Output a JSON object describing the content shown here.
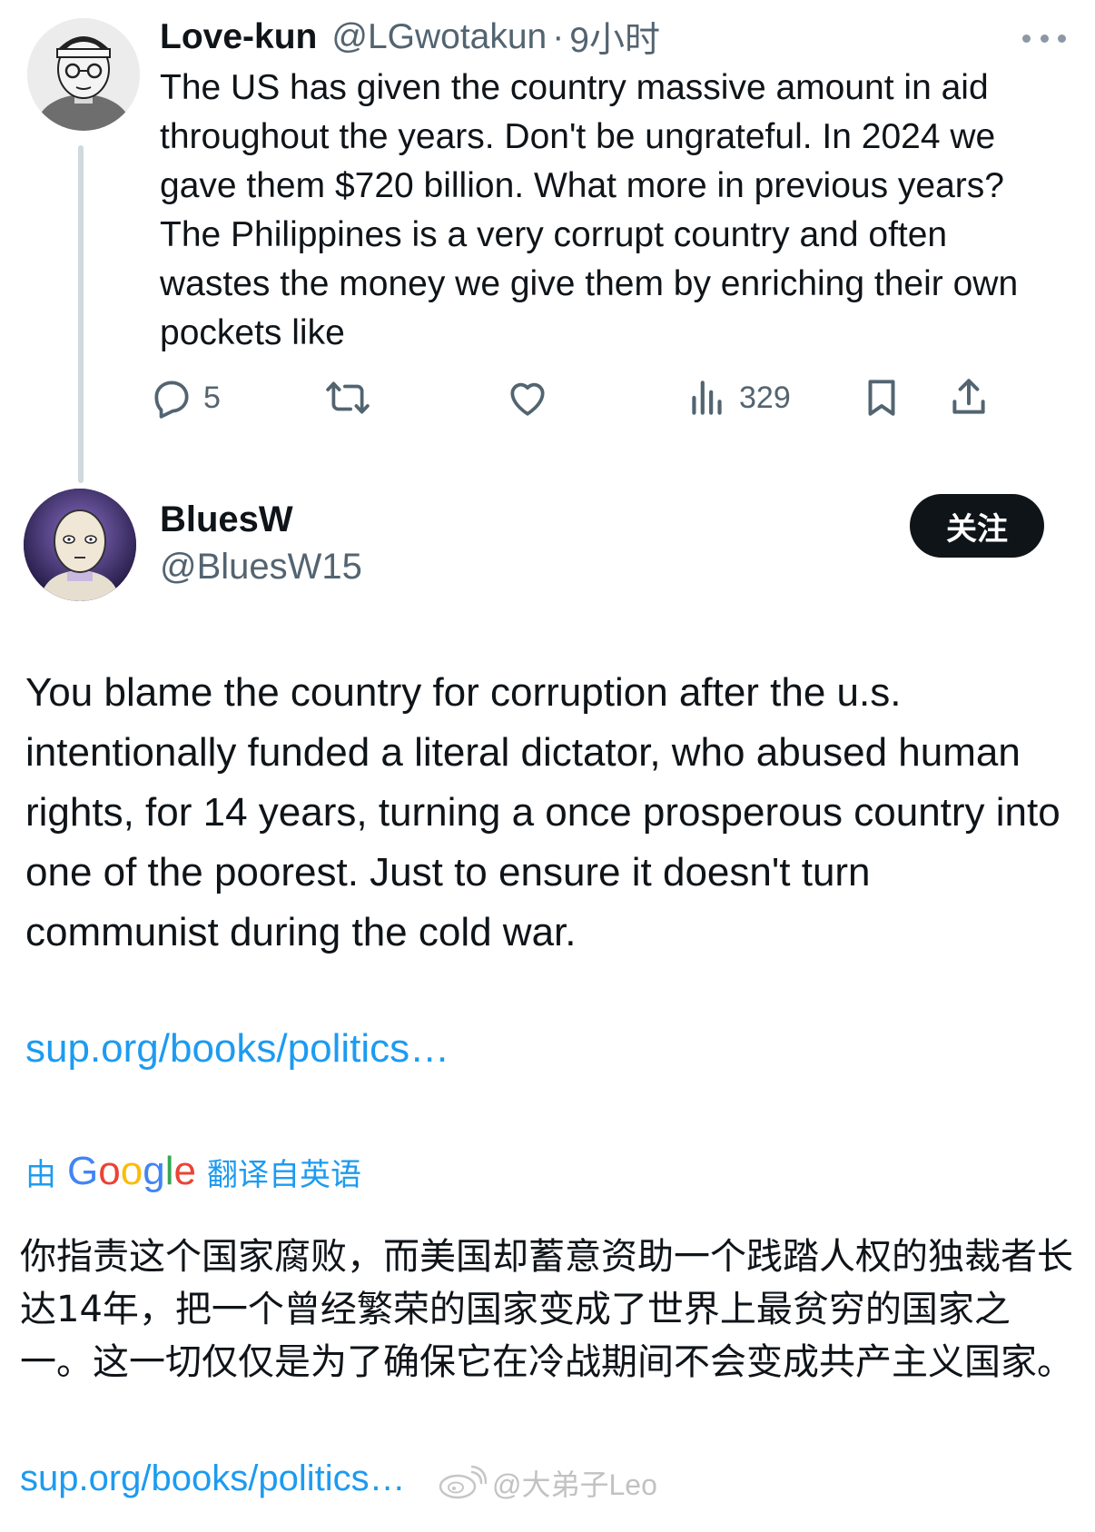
{
  "parent_tweet": {
    "display_name": "Love-kun",
    "handle": "@LGwotakun",
    "separator": "·",
    "time": "9小时",
    "text": "The US has given the country massive amount in aid throughout the years. Don't be ungrateful. In 2024 we gave them $720 billion. What more in previous years? The Philippines is a very corrupt country and often wastes the money we give them by enriching their own pockets like",
    "actions": {
      "reply_count": "5",
      "views_count": "329"
    }
  },
  "reply_tweet": {
    "display_name": "BluesW",
    "handle": "@BluesW15",
    "follow_label": "关注",
    "text": "You blame the country for corruption after the u.s. intentionally funded a literal dictator, who abused human rights, for 14 years, turning a once prosperous country into one of the poorest.  Just to ensure it doesn't turn communist during the cold war.",
    "link": "sup.org/books/politics…",
    "translation": {
      "prefix": "由",
      "provider": "Google",
      "suffix": "翻译自英语",
      "text": "你指责这个国家腐败，而美国却蓄意资助一个践踏人权的独裁者长达14年，把一个曾经繁荣的国家变成了世界上最贫穷的国家之一。这一切仅仅是为了确保它在冷战期间不会变成共产主义国家。",
      "link": "sup.org/books/politics…"
    }
  },
  "watermark": {
    "text": "@大弟子Leo"
  },
  "colors": {
    "link": "#1d9bf0",
    "secondary_text": "#536471",
    "primary_text": "#0f1419",
    "follow_button_bg": "#0f1419"
  },
  "icons": [
    "more-icon",
    "reply-icon",
    "retweet-icon",
    "like-icon",
    "views-icon",
    "bookmark-icon",
    "share-icon",
    "weibo-icon"
  ]
}
